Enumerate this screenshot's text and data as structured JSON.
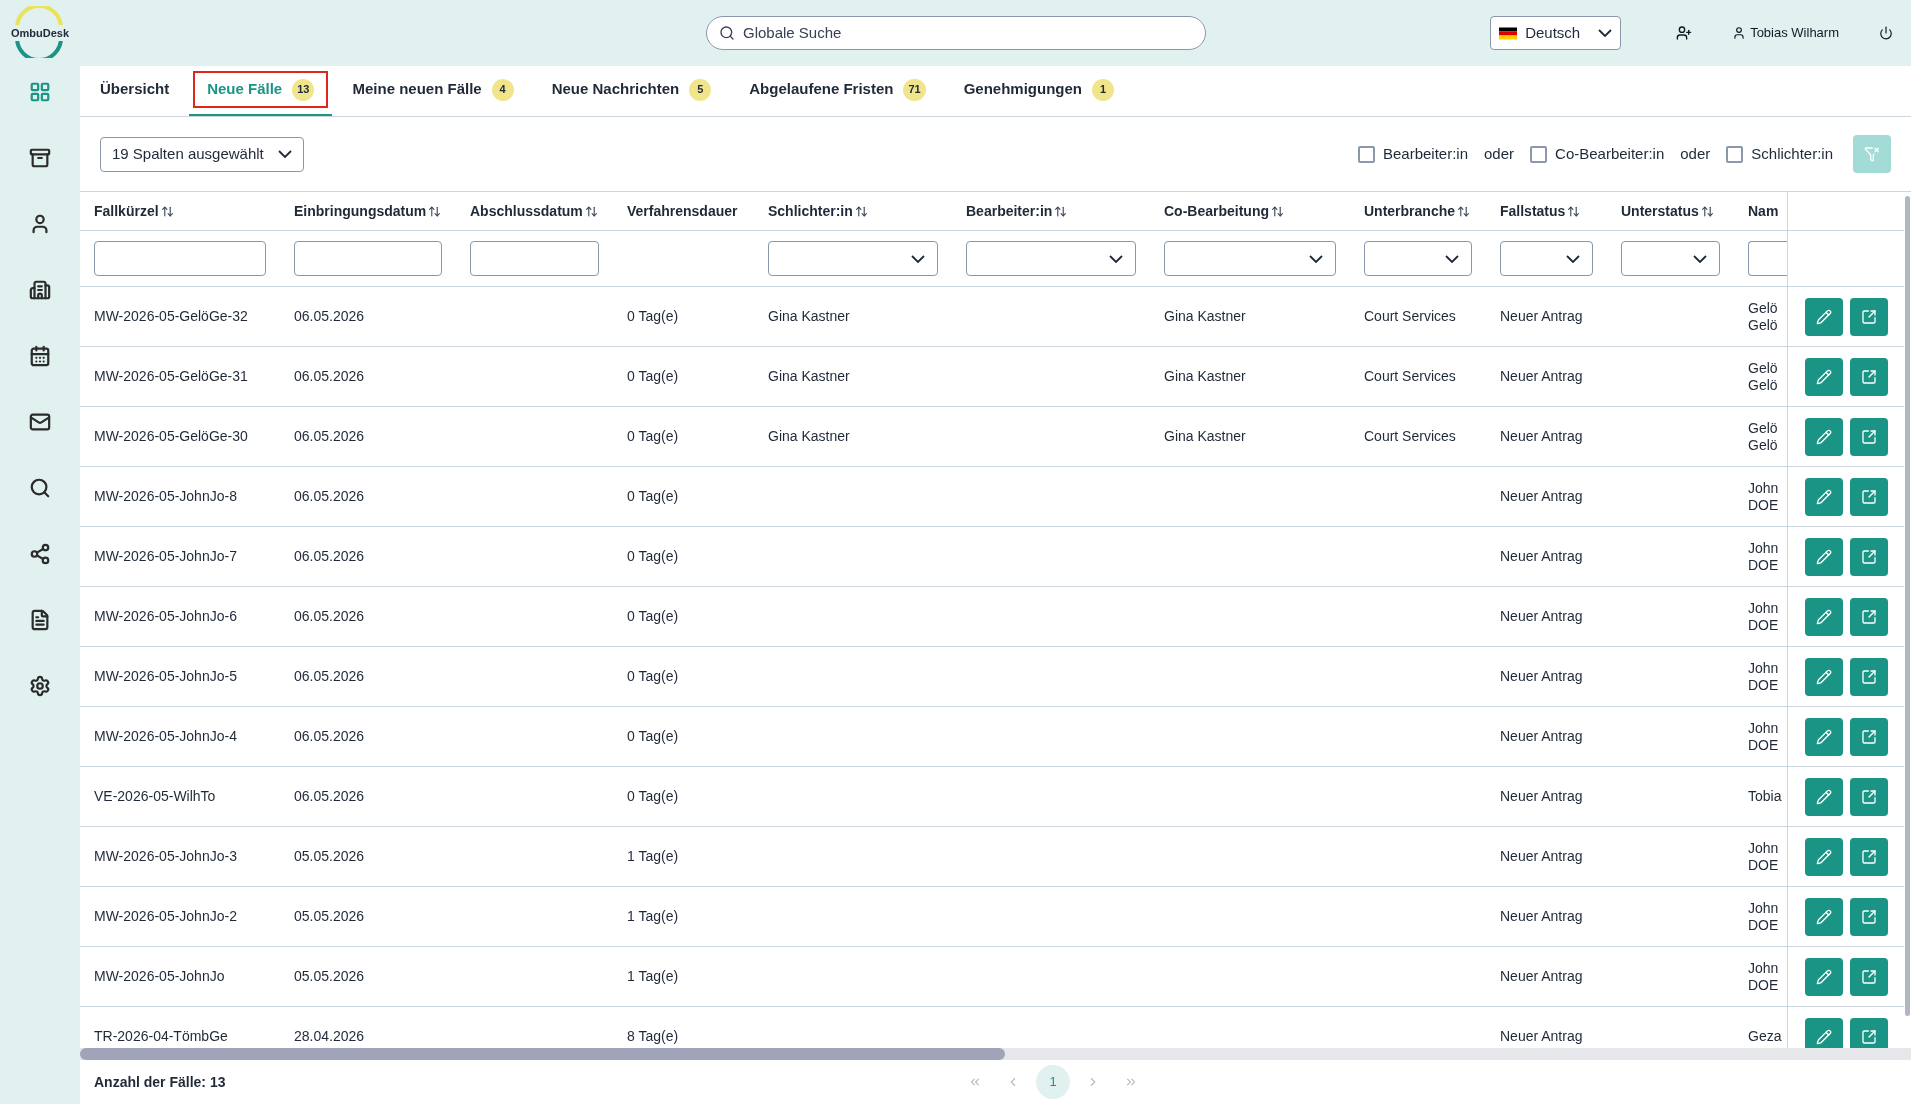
{
  "logo": {
    "text": "OmbuDesk"
  },
  "search": {
    "placeholder": "Globale Suche"
  },
  "language": {
    "value": "Deutsch"
  },
  "user": {
    "name": "Tobias Wilharm"
  },
  "sidebar": {
    "items": [
      {
        "kind": "grid",
        "selected": true
      },
      {
        "kind": "archive",
        "selected": false
      },
      {
        "kind": "user",
        "selected": false
      },
      {
        "kind": "building",
        "selected": false
      },
      {
        "kind": "calendar",
        "selected": false
      },
      {
        "kind": "mail",
        "selected": false
      },
      {
        "kind": "search",
        "selected": false
      },
      {
        "kind": "share",
        "selected": false
      },
      {
        "kind": "file",
        "selected": false
      },
      {
        "kind": "settings",
        "selected": false
      }
    ]
  },
  "tabs": [
    {
      "label": "Übersicht",
      "selected": false,
      "outlined": false
    },
    {
      "label": "Neue Fälle",
      "badge": "13",
      "selected": true,
      "outlined": true
    },
    {
      "label": "Meine neuen Fälle",
      "badge": "4",
      "selected": false,
      "outlined": false
    },
    {
      "label": "Neue Nachrichten",
      "badge": "5",
      "selected": false,
      "outlined": false
    },
    {
      "label": "Abgelaufene Fristen",
      "badge": "71",
      "selected": false,
      "outlined": false
    },
    {
      "label": "Genehmigungen",
      "badge": "1",
      "selected": false,
      "outlined": false
    }
  ],
  "toolbar": {
    "columns_select": "19 Spalten ausgewählt",
    "filters": [
      {
        "kind": "checkbox",
        "label": "Bearbeiter:in",
        "checked": false
      },
      {
        "kind": "text",
        "label": "oder"
      },
      {
        "kind": "checkbox",
        "label": "Co-Bearbeiter:in",
        "checked": false
      },
      {
        "kind": "text",
        "label": "oder"
      },
      {
        "kind": "checkbox",
        "label": "Schlichter:in",
        "checked": false
      }
    ],
    "filter_button": {
      "disabled": true
    }
  },
  "table": {
    "columns": [
      {
        "label": "Fallkürzel",
        "sortable": true
      },
      {
        "label": "Einbringungsdatum",
        "sortable": true
      },
      {
        "label": "Abschlussdatum",
        "sortable": true
      },
      {
        "label": "Verfahrensdauer",
        "sortable": false
      },
      {
        "label": "Schlichter:in",
        "sortable": true
      },
      {
        "label": "Bearbeiter:in",
        "sortable": true
      },
      {
        "label": "Co-Bearbeitung",
        "sortable": true
      },
      {
        "label": "Unterbranche",
        "sortable": true
      },
      {
        "label": "Fallstatus",
        "sortable": true
      },
      {
        "label": "Unterstatus",
        "sortable": true
      },
      {
        "label": "Nam",
        "sortable": false
      }
    ],
    "filters": [
      {
        "kind": "text"
      },
      {
        "kind": "text"
      },
      {
        "kind": "text"
      },
      {
        "kind": "none"
      },
      {
        "kind": "select"
      },
      {
        "kind": "select"
      },
      {
        "kind": "select"
      },
      {
        "kind": "select"
      },
      {
        "kind": "select"
      },
      {
        "kind": "select"
      },
      {
        "kind": "text"
      }
    ],
    "rows": [
      {
        "cells": [
          "MW-2026-05-GelöGe-32",
          "06.05.2026",
          "",
          "0 Tag(e)",
          "Gina Kastner",
          "",
          "Gina Kastner",
          "Court Services",
          "Neuer Antrag",
          "",
          [
            "Gelö",
            "Gelö"
          ]
        ]
      },
      {
        "cells": [
          "MW-2026-05-GelöGe-31",
          "06.05.2026",
          "",
          "0 Tag(e)",
          "Gina Kastner",
          "",
          "Gina Kastner",
          "Court Services",
          "Neuer Antrag",
          "",
          [
            "Gelö",
            "Gelö"
          ]
        ]
      },
      {
        "cells": [
          "MW-2026-05-GelöGe-30",
          "06.05.2026",
          "",
          "0 Tag(e)",
          "Gina Kastner",
          "",
          "Gina Kastner",
          "Court Services",
          "Neuer Antrag",
          "",
          [
            "Gelö",
            "Gelö"
          ]
        ]
      },
      {
        "cells": [
          "MW-2026-05-JohnJo-8",
          "06.05.2026",
          "",
          "0 Tag(e)",
          "",
          "",
          "",
          "",
          "Neuer Antrag",
          "",
          [
            "John",
            "DOE"
          ]
        ]
      },
      {
        "cells": [
          "MW-2026-05-JohnJo-7",
          "06.05.2026",
          "",
          "0 Tag(e)",
          "",
          "",
          "",
          "",
          "Neuer Antrag",
          "",
          [
            "John",
            "DOE"
          ]
        ]
      },
      {
        "cells": [
          "MW-2026-05-JohnJo-6",
          "06.05.2026",
          "",
          "0 Tag(e)",
          "",
          "",
          "",
          "",
          "Neuer Antrag",
          "",
          [
            "John",
            "DOE"
          ]
        ]
      },
      {
        "cells": [
          "MW-2026-05-JohnJo-5",
          "06.05.2026",
          "",
          "0 Tag(e)",
          "",
          "",
          "",
          "",
          "Neuer Antrag",
          "",
          [
            "John",
            "DOE"
          ]
        ]
      },
      {
        "cells": [
          "MW-2026-05-JohnJo-4",
          "06.05.2026",
          "",
          "0 Tag(e)",
          "",
          "",
          "",
          "",
          "Neuer Antrag",
          "",
          [
            "John",
            "DOE"
          ]
        ]
      },
      {
        "cells": [
          "VE-2026-05-WilhTo",
          "06.05.2026",
          "",
          "0 Tag(e)",
          "",
          "",
          "",
          "",
          "Neuer Antrag",
          "",
          [
            "Tobia"
          ]
        ]
      },
      {
        "cells": [
          "MW-2026-05-JohnJo-3",
          "05.05.2026",
          "",
          "1 Tag(e)",
          "",
          "",
          "",
          "",
          "Neuer Antrag",
          "",
          [
            "John",
            "DOE"
          ]
        ]
      },
      {
        "cells": [
          "MW-2026-05-JohnJo-2",
          "05.05.2026",
          "",
          "1 Tag(e)",
          "",
          "",
          "",
          "",
          "Neuer Antrag",
          "",
          [
            "John",
            "DOE"
          ]
        ]
      },
      {
        "cells": [
          "MW-2026-05-JohnJo",
          "05.05.2026",
          "",
          "1 Tag(e)",
          "",
          "",
          "",
          "",
          "Neuer Antrag",
          "",
          [
            "John",
            "DOE"
          ]
        ]
      },
      {
        "cells": [
          "TR-2026-04-TömbGe",
          "28.04.2026",
          "",
          "8 Tag(e)",
          "",
          "",
          "",
          "",
          "Neuer Antrag",
          "",
          [
            "Geza"
          ]
        ]
      }
    ]
  },
  "footer": {
    "count": "Anzahl der Fälle: 13",
    "pages": [
      {
        "label": "1",
        "selected": true
      }
    ]
  }
}
